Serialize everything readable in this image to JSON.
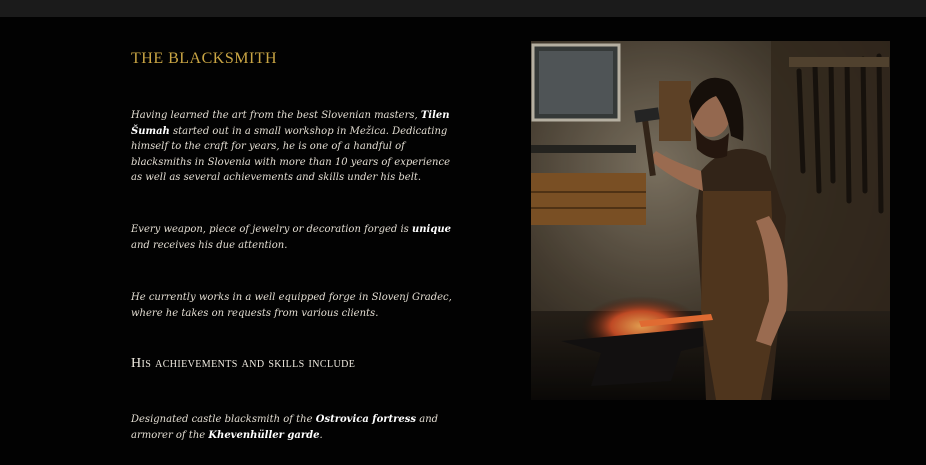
{
  "section": {
    "title": "The Blacksmith"
  },
  "intro": {
    "p1_a": "Having learned the art from the best Slovenian masters, ",
    "p1_name": "Tilen Šumah",
    "p1_b": " started out in a small workshop in Mežica. Dedicating himself to the craft for years, he is one of a handful of blacksmiths in Slovenia with more than 10 years of experience as well as several achievements and skills under his belt.",
    "p2_a": "Every weapon, piece of jewelry or decoration forged is ",
    "p2_bold": "unique",
    "p2_b": " and receives his due attention.",
    "p3": "He currently works in a well equipped forge in Slovenj Gradec, where he takes on requests from various clients."
  },
  "achievements": {
    "heading": "His achievements and skills include",
    "item1_a": "Designated castle blacksmith of the ",
    "item1_place": "Ostrovica fortress",
    "item1_b": " and armorer of the ",
    "item1_garde": "Khevenhüller garde",
    "item1_end": "."
  },
  "colors": {
    "accent_gold": "#c9a544",
    "background": "#020202",
    "text": "#e3ddd2"
  }
}
